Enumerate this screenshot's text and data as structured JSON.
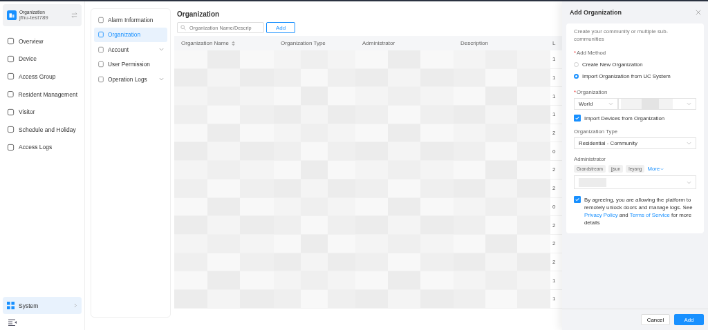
{
  "org_switcher": {
    "label": "Organization",
    "name": "jfhu-test789"
  },
  "nav": [
    {
      "label": "Overview",
      "selected": false
    },
    {
      "label": "Device",
      "selected": false
    },
    {
      "label": "Access Group",
      "selected": false
    },
    {
      "label": "Resident Management",
      "selected": false
    },
    {
      "label": "Visitor",
      "selected": false
    },
    {
      "label": "Schedule and Holiday",
      "selected": false
    },
    {
      "label": "Access Logs",
      "selected": false
    }
  ],
  "system_item": {
    "label": "System",
    "selected": true
  },
  "submenu": [
    {
      "label": "Alarm Information",
      "selected": false,
      "expandable": false
    },
    {
      "label": "Organization",
      "selected": true,
      "expandable": false
    },
    {
      "label": "Account",
      "selected": false,
      "expandable": true
    },
    {
      "label": "User Permission",
      "selected": false,
      "expandable": false
    },
    {
      "label": "Operation Logs",
      "selected": false,
      "expandable": true
    }
  ],
  "page": {
    "title": "Organization",
    "search": {
      "placeholder": "Organization Name/Descrip"
    },
    "add_button": "Add",
    "table": {
      "columns": [
        "Organization Name",
        "Organization Type",
        "Administrator",
        "Description",
        "L"
      ],
      "rows": [
        {
          "column_5": "1"
        },
        {
          "column_5": "1"
        },
        {
          "column_5": "1"
        },
        {
          "column_5": "1"
        },
        {
          "column_5": "2"
        },
        {
          "column_5": "0"
        },
        {
          "column_5": "2"
        },
        {
          "column_5": "2"
        },
        {
          "column_5": "0"
        },
        {
          "column_5": "2"
        },
        {
          "column_5": "2"
        },
        {
          "column_5": "2"
        },
        {
          "column_5": "1"
        },
        {
          "column_5": "1"
        }
      ]
    }
  },
  "drawer": {
    "title": "Add Organization",
    "intro": "Create your community or multiple sub-communities",
    "method_required": "*",
    "method_label": "Add Method",
    "methods": [
      {
        "label": "Create New Organization",
        "selected": false
      },
      {
        "label": "Import Organization from UC System",
        "selected": true
      }
    ],
    "org_required": "*",
    "org_label": "Organization",
    "region": "World",
    "import_devices": {
      "label": "Import Devices from Organization",
      "checked": true
    },
    "type_label": "Organization Type",
    "type_value": "Residential - Community",
    "admin_label": "Administrator",
    "admin_tags": [
      "Grandstream",
      "jjsun",
      "leyang"
    ],
    "more": "More",
    "agreement": {
      "checked": true,
      "parts": [
        {
          "kind": "text",
          "text": "By agreeing, you are allowing the platform to remotely unlock doors and manage logs. See "
        },
        {
          "kind": "link",
          "text": "Privacy Policy"
        },
        {
          "kind": "text",
          "text": " and "
        },
        {
          "kind": "link",
          "text": "Terms of Service"
        },
        {
          "kind": "text",
          "text": " for more details"
        }
      ]
    },
    "cancel": "Cancel",
    "submit": "Add"
  }
}
